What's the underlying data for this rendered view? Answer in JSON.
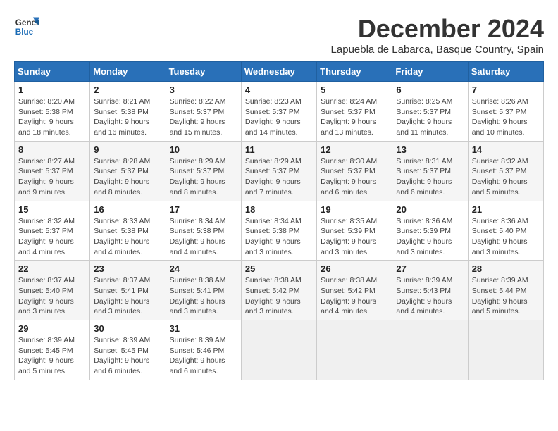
{
  "logo": {
    "line1": "General",
    "line2": "Blue"
  },
  "title": "December 2024",
  "location": "Lapuebla de Labarca, Basque Country, Spain",
  "days_of_week": [
    "Sunday",
    "Monday",
    "Tuesday",
    "Wednesday",
    "Thursday",
    "Friday",
    "Saturday"
  ],
  "weeks": [
    [
      {
        "day": "1",
        "info": "Sunrise: 8:20 AM\nSunset: 5:38 PM\nDaylight: 9 hours\nand 18 minutes."
      },
      {
        "day": "2",
        "info": "Sunrise: 8:21 AM\nSunset: 5:38 PM\nDaylight: 9 hours\nand 16 minutes."
      },
      {
        "day": "3",
        "info": "Sunrise: 8:22 AM\nSunset: 5:37 PM\nDaylight: 9 hours\nand 15 minutes."
      },
      {
        "day": "4",
        "info": "Sunrise: 8:23 AM\nSunset: 5:37 PM\nDaylight: 9 hours\nand 14 minutes."
      },
      {
        "day": "5",
        "info": "Sunrise: 8:24 AM\nSunset: 5:37 PM\nDaylight: 9 hours\nand 13 minutes."
      },
      {
        "day": "6",
        "info": "Sunrise: 8:25 AM\nSunset: 5:37 PM\nDaylight: 9 hours\nand 11 minutes."
      },
      {
        "day": "7",
        "info": "Sunrise: 8:26 AM\nSunset: 5:37 PM\nDaylight: 9 hours\nand 10 minutes."
      }
    ],
    [
      {
        "day": "8",
        "info": "Sunrise: 8:27 AM\nSunset: 5:37 PM\nDaylight: 9 hours\nand 9 minutes."
      },
      {
        "day": "9",
        "info": "Sunrise: 8:28 AM\nSunset: 5:37 PM\nDaylight: 9 hours\nand 8 minutes."
      },
      {
        "day": "10",
        "info": "Sunrise: 8:29 AM\nSunset: 5:37 PM\nDaylight: 9 hours\nand 8 minutes."
      },
      {
        "day": "11",
        "info": "Sunrise: 8:29 AM\nSunset: 5:37 PM\nDaylight: 9 hours\nand 7 minutes."
      },
      {
        "day": "12",
        "info": "Sunrise: 8:30 AM\nSunset: 5:37 PM\nDaylight: 9 hours\nand 6 minutes."
      },
      {
        "day": "13",
        "info": "Sunrise: 8:31 AM\nSunset: 5:37 PM\nDaylight: 9 hours\nand 6 minutes."
      },
      {
        "day": "14",
        "info": "Sunrise: 8:32 AM\nSunset: 5:37 PM\nDaylight: 9 hours\nand 5 minutes."
      }
    ],
    [
      {
        "day": "15",
        "info": "Sunrise: 8:32 AM\nSunset: 5:37 PM\nDaylight: 9 hours\nand 4 minutes."
      },
      {
        "day": "16",
        "info": "Sunrise: 8:33 AM\nSunset: 5:38 PM\nDaylight: 9 hours\nand 4 minutes."
      },
      {
        "day": "17",
        "info": "Sunrise: 8:34 AM\nSunset: 5:38 PM\nDaylight: 9 hours\nand 4 minutes."
      },
      {
        "day": "18",
        "info": "Sunrise: 8:34 AM\nSunset: 5:38 PM\nDaylight: 9 hours\nand 3 minutes."
      },
      {
        "day": "19",
        "info": "Sunrise: 8:35 AM\nSunset: 5:39 PM\nDaylight: 9 hours\nand 3 minutes."
      },
      {
        "day": "20",
        "info": "Sunrise: 8:36 AM\nSunset: 5:39 PM\nDaylight: 9 hours\nand 3 minutes."
      },
      {
        "day": "21",
        "info": "Sunrise: 8:36 AM\nSunset: 5:40 PM\nDaylight: 9 hours\nand 3 minutes."
      }
    ],
    [
      {
        "day": "22",
        "info": "Sunrise: 8:37 AM\nSunset: 5:40 PM\nDaylight: 9 hours\nand 3 minutes."
      },
      {
        "day": "23",
        "info": "Sunrise: 8:37 AM\nSunset: 5:41 PM\nDaylight: 9 hours\nand 3 minutes."
      },
      {
        "day": "24",
        "info": "Sunrise: 8:38 AM\nSunset: 5:41 PM\nDaylight: 9 hours\nand 3 minutes."
      },
      {
        "day": "25",
        "info": "Sunrise: 8:38 AM\nSunset: 5:42 PM\nDaylight: 9 hours\nand 3 minutes."
      },
      {
        "day": "26",
        "info": "Sunrise: 8:38 AM\nSunset: 5:42 PM\nDaylight: 9 hours\nand 4 minutes."
      },
      {
        "day": "27",
        "info": "Sunrise: 8:39 AM\nSunset: 5:43 PM\nDaylight: 9 hours\nand 4 minutes."
      },
      {
        "day": "28",
        "info": "Sunrise: 8:39 AM\nSunset: 5:44 PM\nDaylight: 9 hours\nand 5 minutes."
      }
    ],
    [
      {
        "day": "29",
        "info": "Sunrise: 8:39 AM\nSunset: 5:45 PM\nDaylight: 9 hours\nand 5 minutes."
      },
      {
        "day": "30",
        "info": "Sunrise: 8:39 AM\nSunset: 5:45 PM\nDaylight: 9 hours\nand 6 minutes."
      },
      {
        "day": "31",
        "info": "Sunrise: 8:39 AM\nSunset: 5:46 PM\nDaylight: 9 hours\nand 6 minutes."
      },
      {
        "day": "",
        "info": ""
      },
      {
        "day": "",
        "info": ""
      },
      {
        "day": "",
        "info": ""
      },
      {
        "day": "",
        "info": ""
      }
    ]
  ]
}
